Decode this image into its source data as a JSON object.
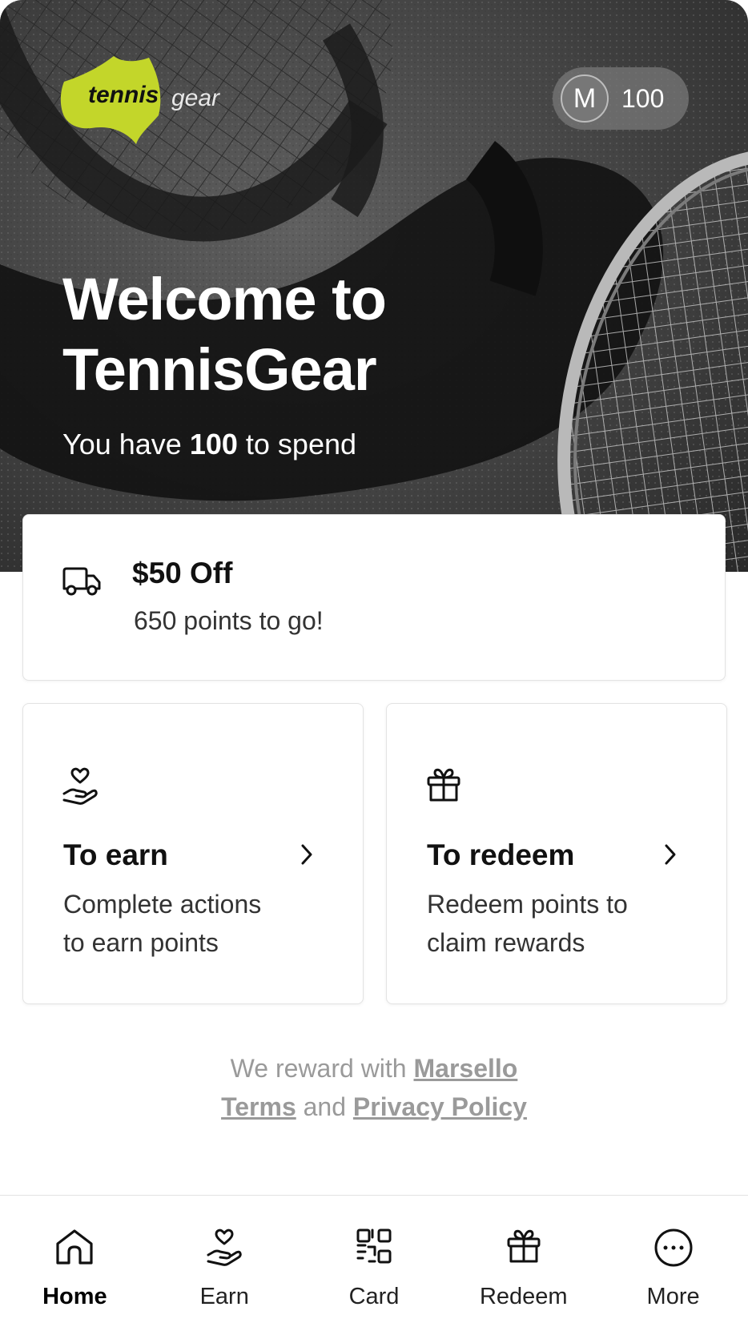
{
  "hero": {
    "logo_text_1": "tennis",
    "logo_text_2": "gear",
    "avatar_initial": "M",
    "points_balance": "100",
    "title_line_1": "Welcome to",
    "title_line_2": "TennisGear",
    "sub_prefix": "You have ",
    "sub_points": "100",
    "sub_suffix": " to spend"
  },
  "reward": {
    "title": "$50 Off",
    "subtitle": "650 points to go!",
    "icon": "truck-icon"
  },
  "actions": [
    {
      "title": "To earn",
      "desc_line_1": "Complete actions",
      "desc_line_2": "to earn points",
      "icon": "hand-heart-icon"
    },
    {
      "title": "To redeem",
      "desc_line_1": "Redeem points to",
      "desc_line_2": "claim rewards",
      "icon": "gift-icon"
    }
  ],
  "footer": {
    "reward_prefix": "We reward with ",
    "reward_link": "Marsello",
    "terms_link": "Terms",
    "and_text": " and ",
    "privacy_link": "Privacy Policy"
  },
  "nav": [
    {
      "label": "Home",
      "icon": "home-icon",
      "active": true
    },
    {
      "label": "Earn",
      "icon": "hand-heart-icon"
    },
    {
      "label": "Card",
      "icon": "qr-code-icon"
    },
    {
      "label": "Redeem",
      "icon": "gift-icon"
    },
    {
      "label": "More",
      "icon": "more-icon"
    }
  ],
  "colors": {
    "logo_green": "#c3d62a",
    "muted_text": "#9a9a9a",
    "border": "#e3e3e3"
  }
}
